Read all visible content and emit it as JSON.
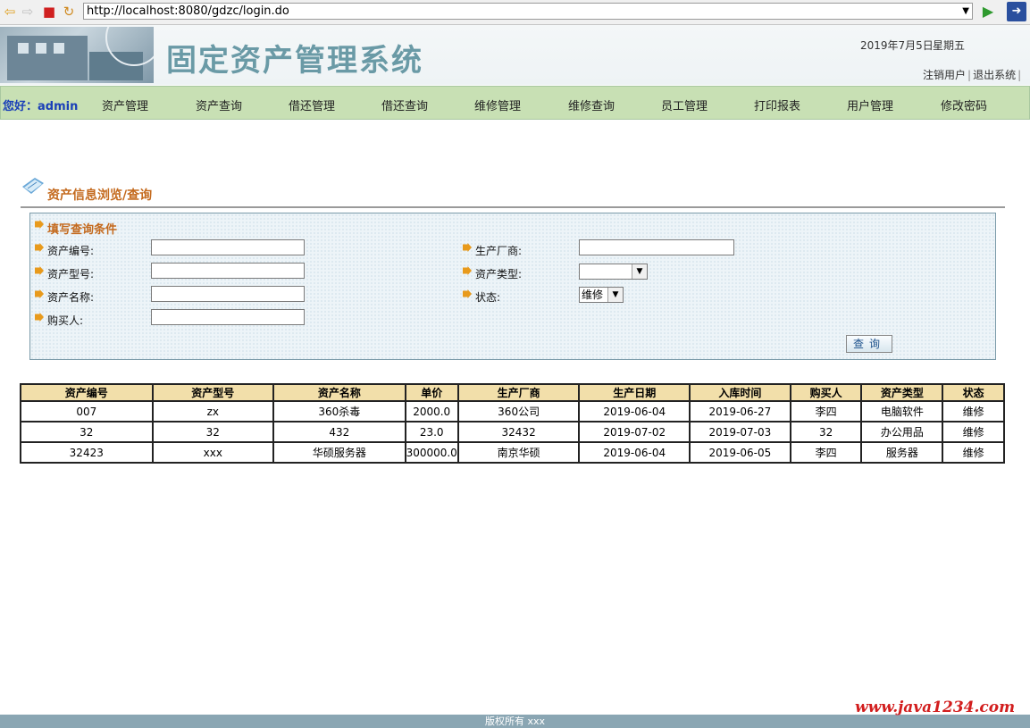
{
  "browser": {
    "url": "http://localhost:8080/gdzc/login.do"
  },
  "header": {
    "system_title": "固定资产管理系统",
    "date": "2019年7月5日",
    "weekday": "星期五",
    "logout_user": "注销用户",
    "separator": "|",
    "exit_system": "退出系统"
  },
  "nav": {
    "greeting": "您好：admin",
    "items": [
      "资产管理",
      "资产查询",
      "借还管理",
      "借还查询",
      "维修管理",
      "维修查询",
      "员工管理",
      "打印报表",
      "用户管理",
      "修改密码"
    ]
  },
  "section": {
    "title": "资产信息浏览/查询"
  },
  "query": {
    "heading": "填写查询条件",
    "asset_no_label": "资产编号:",
    "asset_model_label": "资产型号:",
    "asset_name_label": "资产名称:",
    "buyer_label": "购买人:",
    "manufacturer_label": "生产厂商:",
    "asset_type_label": "资产类型:",
    "status_label": "状态:",
    "asset_no_value": "",
    "asset_model_value": "",
    "asset_name_value": "",
    "buyer_value": "",
    "manufacturer_value": "",
    "asset_type_value": "",
    "status_value": "维修",
    "button_label": "查询"
  },
  "table": {
    "headers": [
      "资产编号",
      "资产型号",
      "资产名称",
      "单价",
      "生产厂商",
      "生产日期",
      "入库时间",
      "购买人",
      "资产类型",
      "状态"
    ],
    "rows": [
      [
        "007",
        "zx",
        "360杀毒",
        "2000.0",
        "360公司",
        "2019-06-04",
        "2019-06-27",
        "李四",
        "电脑软件",
        "维修"
      ],
      [
        "32",
        "32",
        "432",
        "23.0",
        "32432",
        "2019-07-02",
        "2019-07-03",
        "32",
        "办公用品",
        "维修"
      ],
      [
        "32423",
        "xxx",
        "华硕服务器",
        "300000.0",
        "南京华硕",
        "2019-06-04",
        "2019-06-05",
        "李四",
        "服务器",
        "维修"
      ]
    ]
  },
  "footer": {
    "copyright": "版权所有 xxx"
  },
  "watermark": {
    "text": "www.java1234.com"
  },
  "colors": {
    "nav_bg": "#c8e0b4",
    "accent_orange": "#c46a1e",
    "table_header_bg": "#f2dfaa",
    "greeting_blue": "#1a3fb8"
  }
}
